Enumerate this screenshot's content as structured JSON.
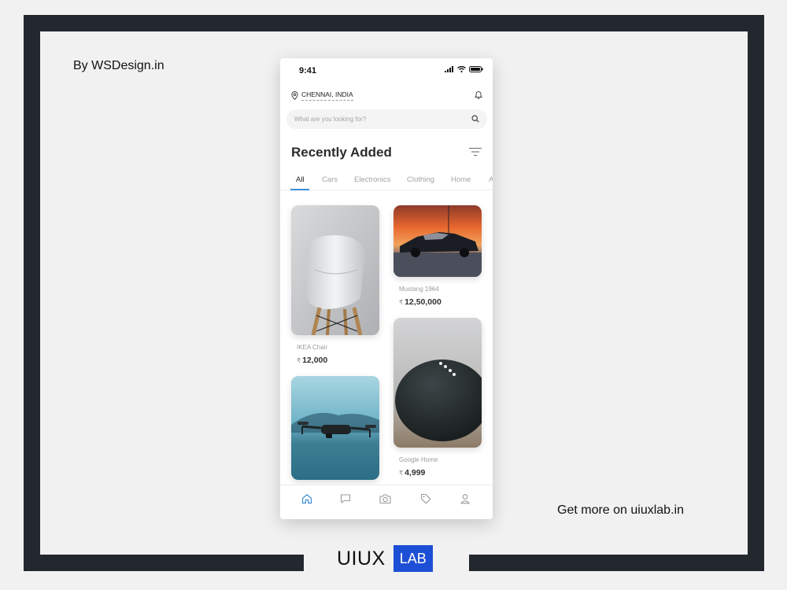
{
  "page": {
    "credit": "By WSDesign.in",
    "more": "Get more on uiuxlab.in",
    "brand_uiux": "UIUX",
    "brand_lab": "LAB"
  },
  "app": {
    "status_time": "9:41",
    "location": "CHENNAI, INDIA",
    "search_placeholder": "What are you looking for?",
    "section_title": "Recently Added",
    "tabs": [
      {
        "label": "All",
        "active": true
      },
      {
        "label": "Cars",
        "active": false
      },
      {
        "label": "Electronics",
        "active": false
      },
      {
        "label": "Clothing",
        "active": false
      },
      {
        "label": "Home",
        "active": false
      },
      {
        "label": "A",
        "active": false
      }
    ],
    "products": [
      {
        "name": "IKEA Chair",
        "currency": "₹",
        "price": "12,000"
      },
      {
        "name": "Mustang 1964",
        "currency": "₹",
        "price": "12,50,000"
      },
      {
        "name": "Google Home",
        "currency": "₹",
        "price": "4,999"
      },
      {
        "name": "",
        "currency": "",
        "price": ""
      }
    ],
    "nav": [
      "home-icon",
      "chat-icon",
      "camera-icon",
      "tag-icon",
      "profile-icon"
    ],
    "colors": {
      "accent": "#3d8dd9",
      "frame": "#23272e",
      "brand": "#1d4fd6"
    }
  }
}
